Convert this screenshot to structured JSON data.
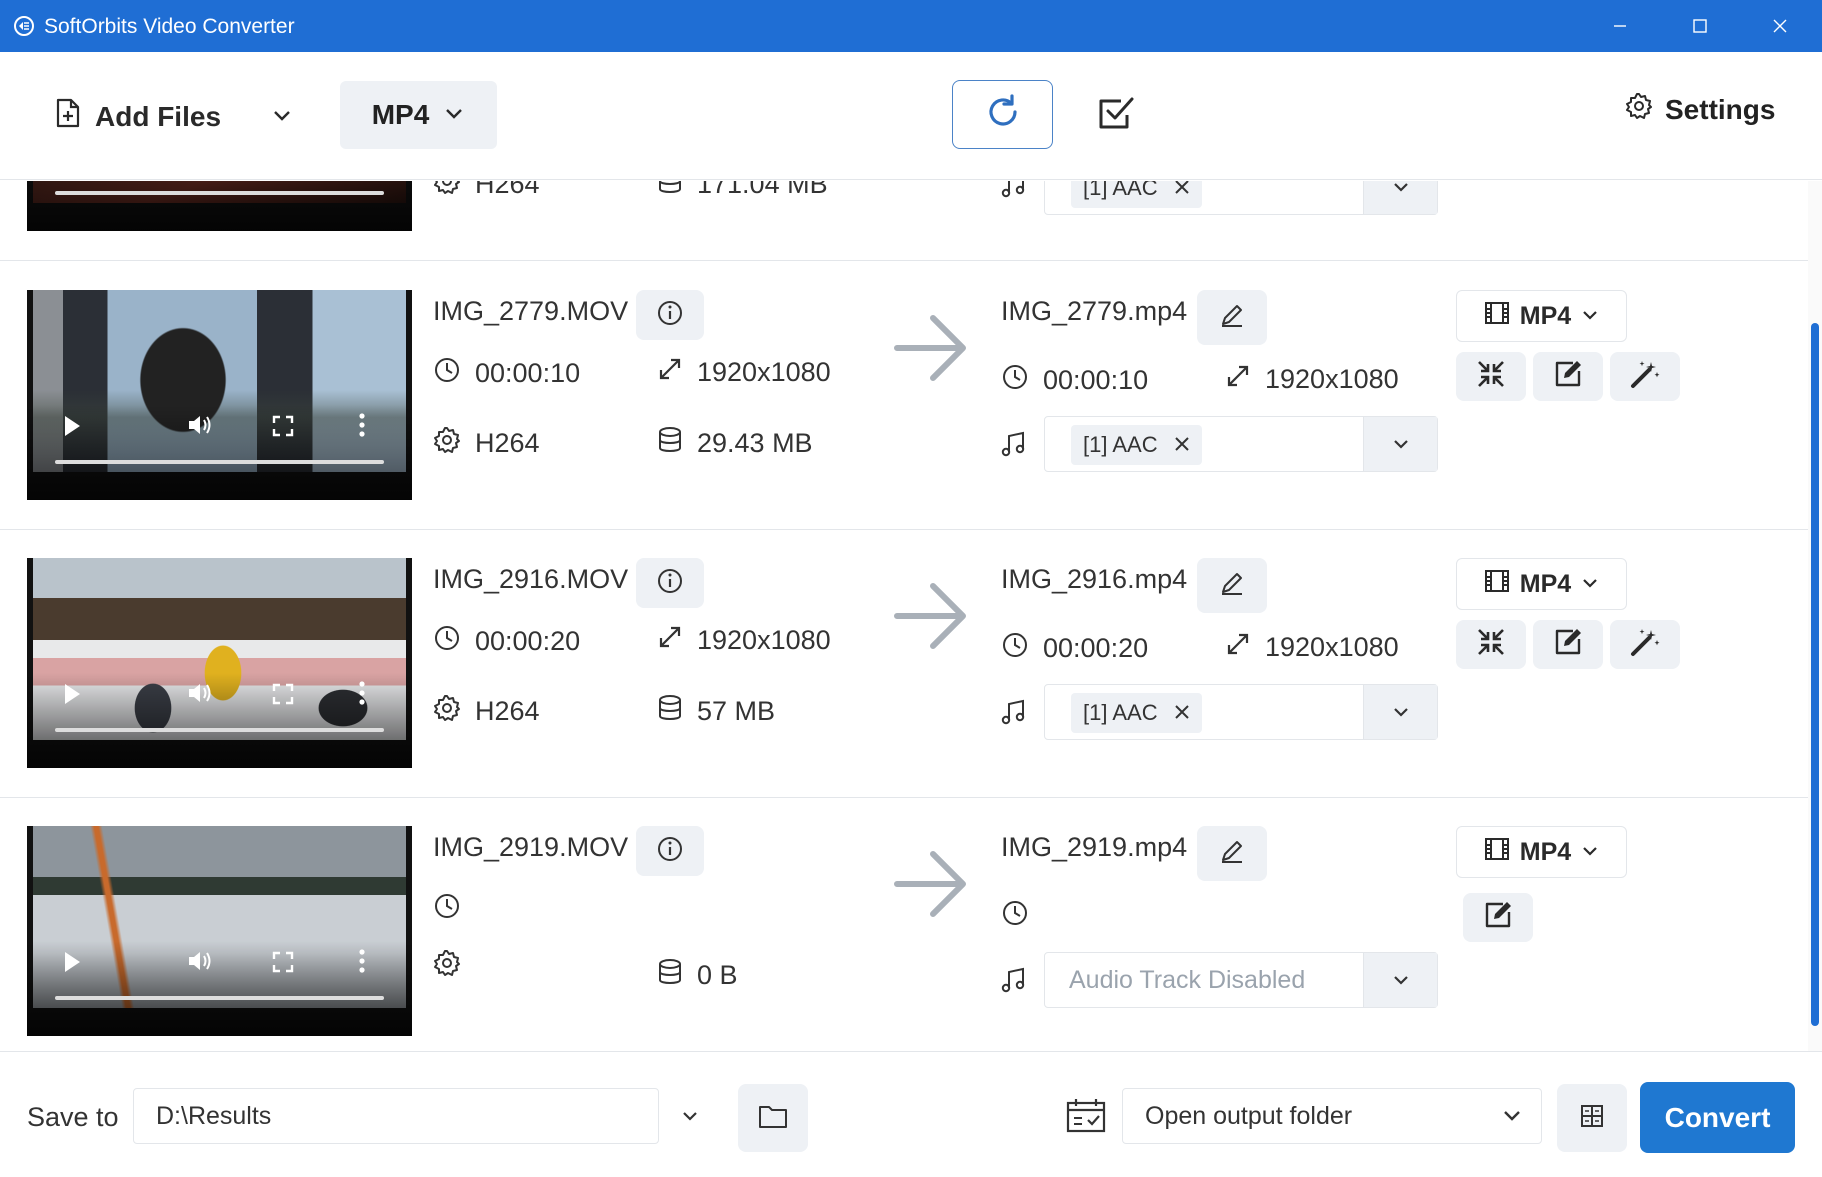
{
  "window": {
    "title": "SoftOrbits Video Converter",
    "accent": "#1f6ed4"
  },
  "toolbar": {
    "add_files_label": "Add Files",
    "format_label": "MP4",
    "settings_label": "Settings",
    "icons": [
      "add-file-icon",
      "chevron-down-icon",
      "refresh-icon",
      "check-square-icon",
      "gear-icon"
    ]
  },
  "files": [
    {
      "source_codec": "H264",
      "source_size": "171.04 MB",
      "audio_chip": "[1] AAC"
    },
    {
      "source_name": "IMG_2779.MOV",
      "source_duration": "00:00:10",
      "source_resolution": "1920x1080",
      "source_codec": "H264",
      "source_size": "29.43 MB",
      "output_name": "IMG_2779.mp4",
      "output_duration": "00:00:10",
      "output_resolution": "1920x1080",
      "audio_chip": "[1] AAC",
      "format": "MP4"
    },
    {
      "source_name": "IMG_2916.MOV",
      "source_duration": "00:00:20",
      "source_resolution": "1920x1080",
      "source_codec": "H264",
      "source_size": "57 MB",
      "output_name": "IMG_2916.mp4",
      "output_duration": "00:00:20",
      "output_resolution": "1920x1080",
      "audio_chip": "[1] AAC",
      "format": "MP4"
    },
    {
      "source_name": "IMG_2919.MOV",
      "source_duration": "",
      "source_resolution": "",
      "source_codec": "",
      "source_size": "0 B",
      "output_name": "IMG_2919.mp4",
      "output_duration": "",
      "audio_placeholder": "Audio Track Disabled",
      "format": "MP4"
    }
  ],
  "bottom": {
    "save_to_label": "Save to",
    "save_path": "D:\\Results",
    "after_action": "Open output folder",
    "convert_label": "Convert"
  }
}
